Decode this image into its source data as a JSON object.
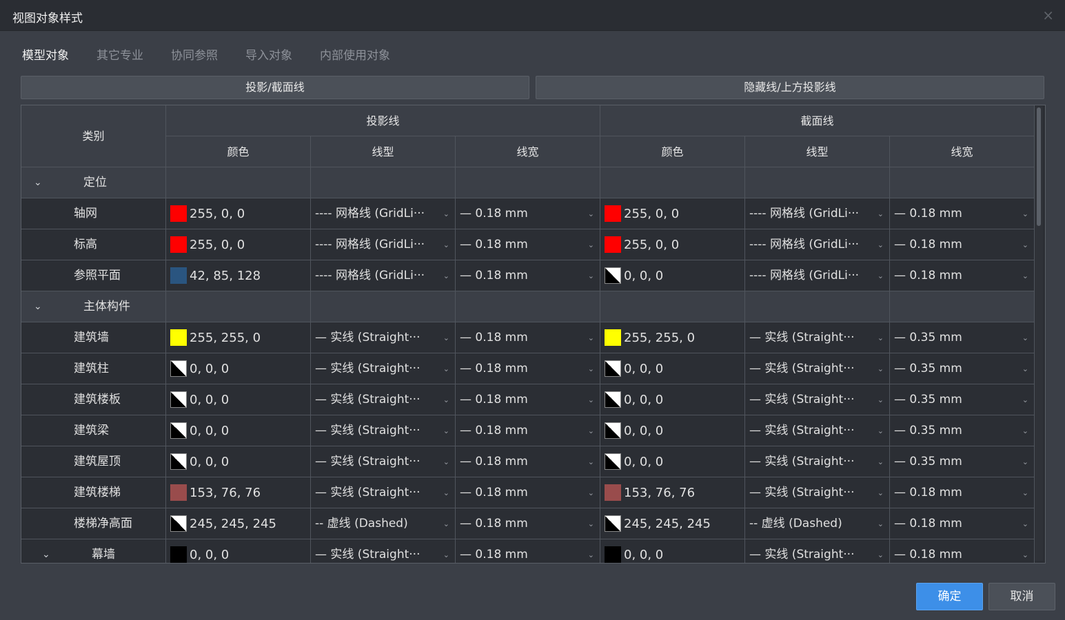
{
  "window": {
    "title": "视图对象样式",
    "close_icon": "×"
  },
  "tabs": [
    {
      "label": "模型对象",
      "active": true
    },
    {
      "label": "其它专业",
      "active": false
    },
    {
      "label": "协同参照",
      "active": false
    },
    {
      "label": "导入对象",
      "active": false
    },
    {
      "label": "内部使用对象",
      "active": false
    }
  ],
  "subtabs": [
    "投影/截面线",
    "隐藏线/上方投影线"
  ],
  "table": {
    "category_header": "类别",
    "projection_header": "投影线",
    "section_header": "截面线",
    "col_color": "颜色",
    "col_linetype": "线型",
    "col_linewidth": "线宽",
    "rows": [
      {
        "kind": "group",
        "name": "定位"
      },
      {
        "kind": "item",
        "name": "轴网",
        "p_color": "255, 0, 0",
        "p_hex": "#ff0000",
        "p_type": "---- 网格线 (GridLi···",
        "p_width": "— 0.18 mm",
        "s_color": "255, 0, 0",
        "s_hex": "#ff0000",
        "s_type": "---- 网格线 (GridLi···",
        "s_width": "— 0.18 mm"
      },
      {
        "kind": "item",
        "name": "标高",
        "p_color": "255, 0, 0",
        "p_hex": "#ff0000",
        "p_type": "---- 网格线 (GridLi···",
        "p_width": "— 0.18 mm",
        "s_color": "255, 0, 0",
        "s_hex": "#ff0000",
        "s_type": "---- 网格线 (GridLi···",
        "s_width": "— 0.18 mm"
      },
      {
        "kind": "item",
        "name": "参照平面",
        "p_color": "42, 85, 128",
        "p_hex": "#2a5580",
        "p_type": "---- 网格线 (GridLi···",
        "p_width": "— 0.18 mm",
        "s_color": "0, 0, 0",
        "s_hex": "bw",
        "s_type": "---- 网格线 (GridLi···",
        "s_width": "— 0.18 mm"
      },
      {
        "kind": "group",
        "name": "主体构件"
      },
      {
        "kind": "item",
        "name": "建筑墙",
        "p_color": "255, 255, 0",
        "p_hex": "#ffff00",
        "p_type": "— 实线 (Straight···",
        "p_width": "— 0.18 mm",
        "s_color": "255, 255, 0",
        "s_hex": "#ffff00",
        "s_type": "— 实线 (Straight···",
        "s_width": "— 0.35 mm"
      },
      {
        "kind": "item",
        "name": "建筑柱",
        "p_color": "0, 0, 0",
        "p_hex": "bw",
        "p_type": "— 实线 (Straight···",
        "p_width": "— 0.18 mm",
        "s_color": "0, 0, 0",
        "s_hex": "bw",
        "s_type": "— 实线 (Straight···",
        "s_width": "— 0.35 mm"
      },
      {
        "kind": "item",
        "name": "建筑楼板",
        "p_color": "0, 0, 0",
        "p_hex": "bw",
        "p_type": "— 实线 (Straight···",
        "p_width": "— 0.18 mm",
        "s_color": "0, 0, 0",
        "s_hex": "bw",
        "s_type": "— 实线 (Straight···",
        "s_width": "— 0.35 mm"
      },
      {
        "kind": "item",
        "name": "建筑梁",
        "p_color": "0, 0, 0",
        "p_hex": "bw",
        "p_type": "— 实线 (Straight···",
        "p_width": "— 0.18 mm",
        "s_color": "0, 0, 0",
        "s_hex": "bw",
        "s_type": "— 实线 (Straight···",
        "s_width": "— 0.35 mm"
      },
      {
        "kind": "item",
        "name": "建筑屋顶",
        "p_color": "0, 0, 0",
        "p_hex": "bw",
        "p_type": "— 实线 (Straight···",
        "p_width": "— 0.18 mm",
        "s_color": "0, 0, 0",
        "s_hex": "bw",
        "s_type": "— 实线 (Straight···",
        "s_width": "— 0.35 mm"
      },
      {
        "kind": "item",
        "name": "建筑楼梯",
        "p_color": "153, 76, 76",
        "p_hex": "#994c4c",
        "p_type": "— 实线 (Straight···",
        "p_width": "— 0.18 mm",
        "s_color": "153, 76, 76",
        "s_hex": "#994c4c",
        "s_type": "— 实线 (Straight···",
        "s_width": "— 0.18 mm"
      },
      {
        "kind": "item",
        "name": "楼梯净高面",
        "p_color": "245, 245, 245",
        "p_hex": "bw",
        "p_type": "-- 虚线 (Dashed)",
        "p_width": "— 0.18 mm",
        "s_color": "245, 245, 245",
        "s_hex": "bw",
        "s_type": "-- 虚线 (Dashed)",
        "s_width": "— 0.18 mm"
      },
      {
        "kind": "subgroup",
        "name": "幕墙",
        "p_color": "0, 0, 0",
        "p_hex": "#000000",
        "p_type": "— 实线 (Straight···",
        "p_width": "— 0.18 mm",
        "s_color": "0, 0, 0",
        "s_hex": "#000000",
        "s_type": "— 实线 (Straight···",
        "s_width": "— 0.18 mm"
      }
    ]
  },
  "buttons": {
    "ok": "确定",
    "cancel": "取消"
  }
}
